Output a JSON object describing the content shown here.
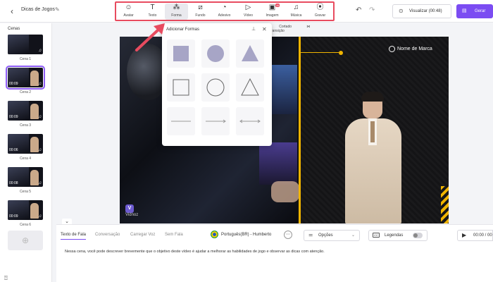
{
  "header": {
    "back_icon": "chevron-left-icon",
    "project_title": "Dicas de Jogos",
    "edit_icon": "pencil-icon",
    "toolbar": [
      {
        "label": "Avatar",
        "icon": "avatar-icon",
        "glyph": "☺"
      },
      {
        "label": "Texto",
        "icon": "text-icon",
        "glyph": "T"
      },
      {
        "label": "Forma",
        "icon": "shapes-icon",
        "glyph": "⁂",
        "active": true
      },
      {
        "label": "Fundo",
        "icon": "background-icon",
        "glyph": "⧄"
      },
      {
        "label": "Adesivo",
        "icon": "sticker-icon",
        "glyph": "◔"
      },
      {
        "label": "Vídeo",
        "icon": "video-icon",
        "glyph": "▷"
      },
      {
        "label": "Imagem",
        "icon": "image-icon",
        "glyph": "▣",
        "badge": "AI"
      },
      {
        "label": "Música",
        "icon": "music-icon",
        "glyph": "♫"
      },
      {
        "label": "Gravar",
        "icon": "record-icon",
        "glyph": "⦿"
      }
    ],
    "undo_icon": "undo-icon",
    "redo_icon": "redo-icon",
    "preview_label": "Visualizar (00:48)",
    "generate_label": "Gerar"
  },
  "scenes": {
    "label": "Cenas",
    "items": [
      {
        "name": "Cena 1",
        "duration": ""
      },
      {
        "name": "Cena 2",
        "duration": "00:09",
        "active": true
      },
      {
        "name": "Cena 3",
        "duration": "00:09"
      },
      {
        "name": "Cena 4",
        "duration": "00:06"
      },
      {
        "name": "Cena 5",
        "duration": "00:08"
      },
      {
        "name": "Cena 6",
        "duration": "00:09"
      }
    ],
    "add_icon": "plus-icon"
  },
  "floatbar": {
    "cortado": "Cortado",
    "transicao": "Transição"
  },
  "shapes_popup": {
    "title": "Adicionar Formas",
    "pin_icon": "pin-icon",
    "close_icon": "close-icon",
    "shapes": [
      "square-filled",
      "circle-filled",
      "triangle-filled",
      "square-outline",
      "circle-outline",
      "triangle-outline",
      "line",
      "arrow-line",
      "double-arrow-line"
    ]
  },
  "canvas": {
    "brand_name": "Nome de Marca",
    "watermark": "Vidnoz",
    "accent_color": "#f0b400"
  },
  "bottom": {
    "tabs": [
      "Texto de Fala",
      "Conversação",
      "Carregar Voz",
      "Sem Fala"
    ],
    "voice": "Português(BR) - Humberto",
    "options_label": "Opções",
    "subtitles_label": "Legendas",
    "play_label": "00:00 / 00",
    "script": "Nessa cena, você pode descrever brevemente que o objetivo deste vídeo é ajudar a melhorar as habilidades de jogo e observar as dicas com atenção."
  },
  "colors": {
    "primary": "#7b4cf2",
    "highlight_box": "#e84b5f"
  }
}
